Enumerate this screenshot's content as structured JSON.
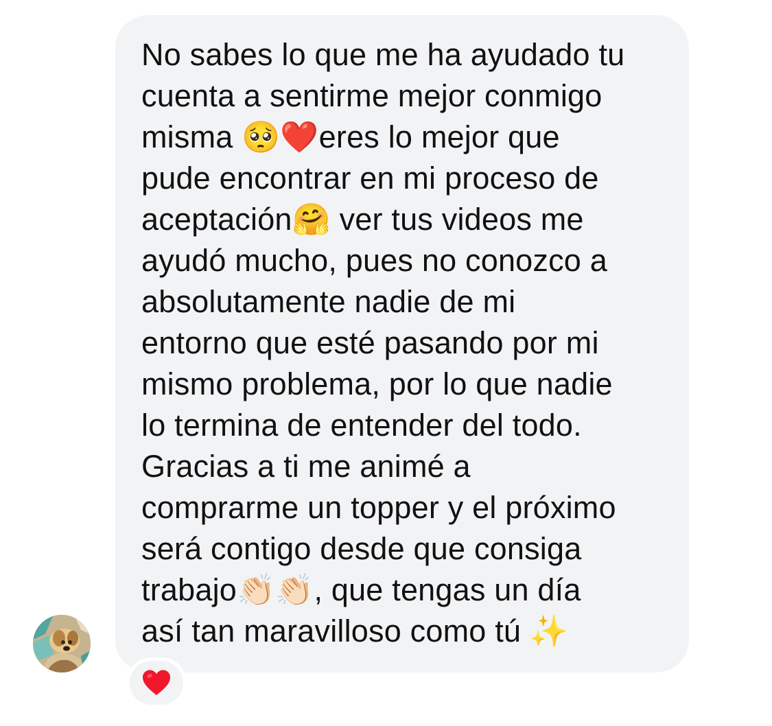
{
  "message": {
    "text": "No sabes lo que me ha ayudado tu\ncuenta a sentirme mejor conmigo\nmisma 🥺❤️eres lo mejor que\npude encontrar en mi proceso de\naceptación🤗 ver tus videos me\nayudó mucho, pues no conozco a\nabsolutamente nadie de mi\nentorno que esté pasando por mi\nmismo problema, por lo que nadie\nlo termina de entender del todo.\nGracias a ti me animé a\ncomprarme un topper y el próximo\nserá contigo desde que consiga\ntrabajo👏🏻👏🏻, que tengas un día\nasí tan maravilloso como tú ✨"
  },
  "reaction": {
    "icon": "heart-icon",
    "color": "#f0172b"
  },
  "colors": {
    "bubble_background": "#f2f3f5",
    "text": "#111111",
    "page_background": "#ffffff"
  }
}
